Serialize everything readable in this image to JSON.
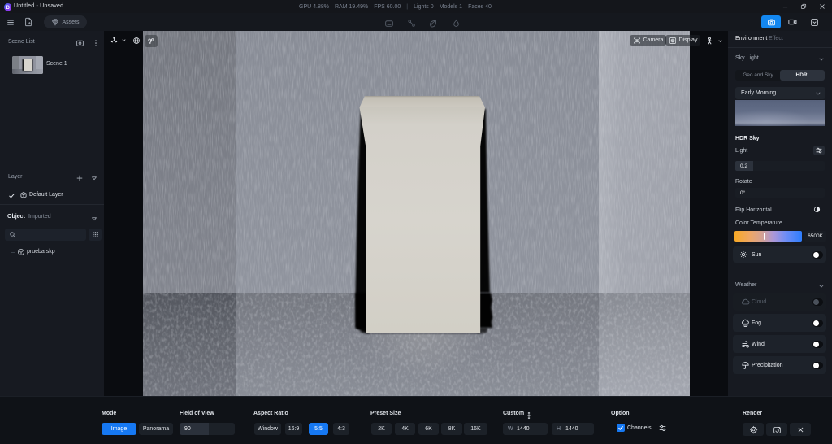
{
  "titlebar": {
    "title": "Untitled - Unsaved",
    "stats": {
      "gpu": "GPU 4.88%",
      "ram": "RAM 19.49%",
      "fps": "FPS 60.00",
      "sep": "|",
      "lights": "Lights 0",
      "models": "Models 1",
      "faces": "Faces 40"
    }
  },
  "toolbar": {
    "assets_label": "Assets"
  },
  "left_panel": {
    "scene_list_title": "Scene List",
    "scenes": [
      {
        "name": "Scene 1"
      }
    ],
    "layer_title": "Layer",
    "layers": [
      {
        "name": "Default Layer"
      }
    ],
    "object_title": "Object",
    "object_filter": "Imported",
    "search_placeholder": "",
    "objects": [
      {
        "name": "prueba.skp"
      }
    ]
  },
  "viewport": {
    "camera_button": "Camera",
    "display_button": "Display"
  },
  "right_panel": {
    "tabs": [
      {
        "label": "Environment"
      },
      {
        "label": "Effect"
      }
    ],
    "active_tab": "Environment",
    "sky_light": {
      "title": "Sky Light",
      "source_options": [
        "Geo and Sky",
        "HDRI"
      ],
      "source_selected": "HDRI",
      "hdri_preset": "Early Morning",
      "hdr_sky_label": "HDR Sky",
      "light_label": "Light",
      "light_value": "0.2",
      "rotate_label": "Rotate",
      "rotate_value": "0°",
      "flip_label": "Flip Horizontal",
      "color_temp_label": "Color Temperature",
      "color_temp_value": "6500K",
      "sun_label": "Sun",
      "sun_on": false
    },
    "weather": {
      "title": "Weather",
      "rows": [
        {
          "label": "Cloud",
          "enabled": false,
          "on": false
        },
        {
          "label": "Fog",
          "enabled": true,
          "on": false
        },
        {
          "label": "Wind",
          "enabled": true,
          "on": false
        },
        {
          "label": "Precipitation",
          "enabled": true,
          "on": false
        }
      ]
    }
  },
  "bottombar": {
    "mode": {
      "label": "Mode",
      "options": [
        "Image",
        "Panorama"
      ],
      "selected": "Image"
    },
    "fov": {
      "label": "Field of View",
      "value": "90"
    },
    "aspect": {
      "label": "Aspect Ratio",
      "options": [
        "Window",
        "16:9",
        "5:5",
        "4:3"
      ],
      "selected": "5:5"
    },
    "preset": {
      "label": "Preset Size",
      "options": [
        "2K",
        "4K",
        "6K",
        "8K",
        "16K"
      ]
    },
    "custom": {
      "label": "Custom",
      "w_prefix": "W",
      "w_value": "1440",
      "h_prefix": "H",
      "h_value": "1440"
    },
    "option": {
      "label": "Option",
      "channels_label": "Channels",
      "channels_checked": true
    },
    "render": {
      "label": "Render"
    }
  },
  "colors": {
    "accent": "#1678f2",
    "camera_active": "#1387f0",
    "temp_gradient_start": "#f7a825",
    "temp_gradient_end": "#2e7dfd"
  }
}
